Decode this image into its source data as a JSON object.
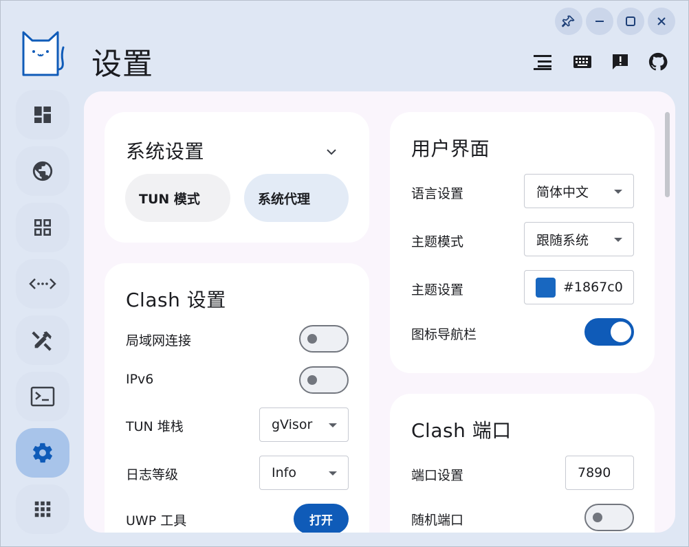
{
  "window_controls": {
    "pin": "pin-icon",
    "minimize": "minimize-icon",
    "maximize": "maximize-icon",
    "close": "close-icon"
  },
  "header": {
    "title": "设置",
    "actions": [
      "list-icon",
      "keyboard-icon",
      "feedback-icon",
      "github-icon"
    ]
  },
  "sidebar": {
    "items": [
      {
        "icon": "dashboard-icon",
        "active": false
      },
      {
        "icon": "globe-icon",
        "active": false
      },
      {
        "icon": "grid-icon",
        "active": false
      },
      {
        "icon": "code-arrows-icon",
        "active": false
      },
      {
        "icon": "tools-icon",
        "active": false
      },
      {
        "icon": "terminal-icon",
        "active": false
      },
      {
        "icon": "settings-icon",
        "active": true
      },
      {
        "icon": "apps-icon",
        "active": false
      }
    ]
  },
  "system_settings": {
    "title": "系统设置",
    "tun_mode": "TUN 模式",
    "system_proxy": "系统代理"
  },
  "clash_settings": {
    "title": "Clash 设置",
    "lan_label": "局域网连接",
    "lan_enabled": false,
    "ipv6_label": "IPv6",
    "ipv6_enabled": false,
    "tun_stack_label": "TUN 堆栈",
    "tun_stack_value": "gVisor",
    "log_level_label": "日志等级",
    "log_level_value": "Info",
    "uwp_label": "UWP 工具",
    "uwp_button": "打开"
  },
  "ui_settings": {
    "title": "用户界面",
    "language_label": "语言设置",
    "language_value": "简体中文",
    "theme_mode_label": "主题模式",
    "theme_mode_value": "跟随系统",
    "theme_color_label": "主题设置",
    "theme_color_value": "#1867c0",
    "icon_nav_label": "图标导航栏",
    "icon_nav_enabled": true
  },
  "clash_ports": {
    "title": "Clash 端口",
    "port_label": "端口设置",
    "port_value": "7890",
    "random_port_label": "随机端口",
    "random_port_enabled": false
  },
  "colors": {
    "accent": "#0f5bb8",
    "theme_swatch": "#1867c0",
    "background": "#dfe7f4",
    "surface": "#faf5fc"
  }
}
